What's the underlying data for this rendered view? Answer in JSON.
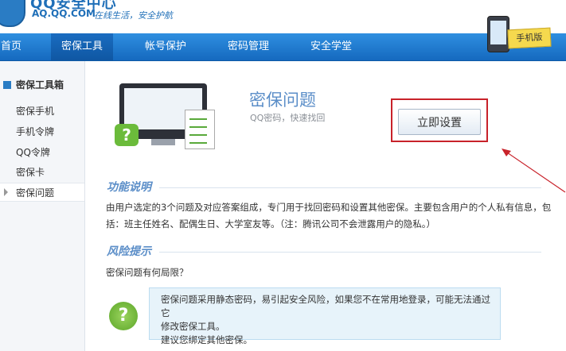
{
  "header": {
    "site_title": "QQ安全中心",
    "url": "AQ.QQ.COM",
    "slogan": "在线生活，安全护航",
    "mobile_badge": "手机版"
  },
  "nav": {
    "items": [
      "首页",
      "密保工具",
      "帐号保护",
      "密码管理",
      "安全学堂"
    ],
    "active_index": 1
  },
  "sidebar": {
    "heading": "密保工具箱",
    "items": [
      "密保手机",
      "手机令牌",
      "QQ令牌",
      "密保卡",
      "密保问题"
    ],
    "active_index": 4
  },
  "feature": {
    "title": "密保问题",
    "subtitle": "QQ密码，快速找回",
    "setup_button": "立即设置"
  },
  "sections": {
    "function_title": "功能说明",
    "function_line1": "由用户选定的3个问题及对应答案组成，专门用于找回密码和设置其他密保。主要包含用户的个人私有信息，包",
    "function_line2": "括：班主任姓名、配偶生日、大学室友等。（注：腾讯公司不会泄露用户的隐私。）",
    "risk_title": "风险提示",
    "risk_question": "密保问题有何局限？",
    "notice_line1": "密保问题采用静态密码，易引起安全风险，如果您不在常用地登录，可能无法通过它",
    "notice_line2": "修改密保工具。",
    "notice_line3": "建议您绑定其他密保。"
  },
  "colors": {
    "nav_blue": "#1f7bd0",
    "highlight_red": "#c8222a",
    "section_blue": "#5b8ec8",
    "notice_bg": "#e7f3fa"
  }
}
